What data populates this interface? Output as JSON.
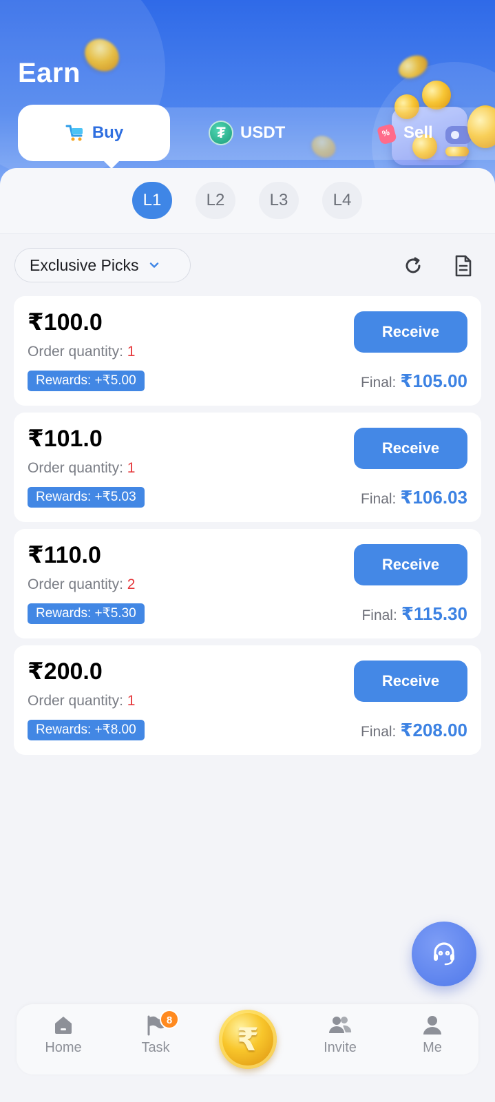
{
  "header": {
    "title": "Earn"
  },
  "top_tabs": {
    "buy": "Buy",
    "usdt": "USDT",
    "usdt_symbol": "₮",
    "sell": "Sell",
    "active": "Buy"
  },
  "levels": [
    "L1",
    "L2",
    "L3",
    "L4"
  ],
  "active_level": "L1",
  "filter": {
    "selected": "Exclusive Picks"
  },
  "labels": {
    "order_quantity": "Order quantity: ",
    "rewards_prefix": "Rewards: ",
    "final": "Final:",
    "receive": "Receive"
  },
  "orders": [
    {
      "price": "₹100.0",
      "quantity": "1",
      "rewards": "+₹5.00",
      "final": "₹105.00"
    },
    {
      "price": "₹101.0",
      "quantity": "1",
      "rewards": "+₹5.03",
      "final": "₹106.03"
    },
    {
      "price": "₹110.0",
      "quantity": "2",
      "rewards": "+₹5.30",
      "final": "₹115.30"
    },
    {
      "price": "₹200.0",
      "quantity": "1",
      "rewards": "+₹8.00",
      "final": "₹208.00"
    }
  ],
  "bottom_nav": {
    "home": "Home",
    "task": "Task",
    "task_badge": "8",
    "center_symbol": "₹",
    "invite": "Invite",
    "me": "Me"
  },
  "colors": {
    "primary": "#4488e6",
    "header_top": "#2f6ae8",
    "quantity_red": "#e5383b",
    "badge_orange": "#ff8a1f",
    "background": "#f3f4f8"
  }
}
